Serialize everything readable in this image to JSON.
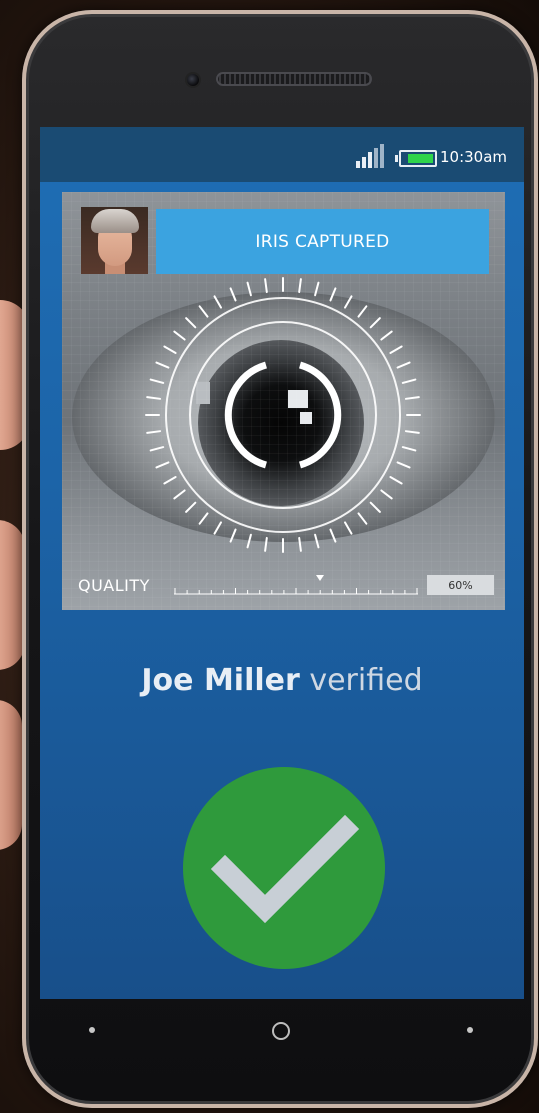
{
  "status_bar": {
    "time": "10:30am",
    "battery_level": 0.85,
    "signal_bars": 4
  },
  "scan": {
    "banner": "IRIS CAPTURED",
    "quality_label": "QUALITY",
    "quality_value": "60%",
    "quality_fraction": 0.6
  },
  "result": {
    "name": "Joe Miller",
    "status": "verified"
  },
  "icons": {
    "check": "checkmark-icon",
    "home": "home-circle-icon"
  },
  "colors": {
    "screen_blue": "#1f6eb5",
    "status_bar": "#1a4b73",
    "banner": "#3ba3e0",
    "success_green": "#2f9a3c",
    "battery_green": "#2fd44b"
  }
}
